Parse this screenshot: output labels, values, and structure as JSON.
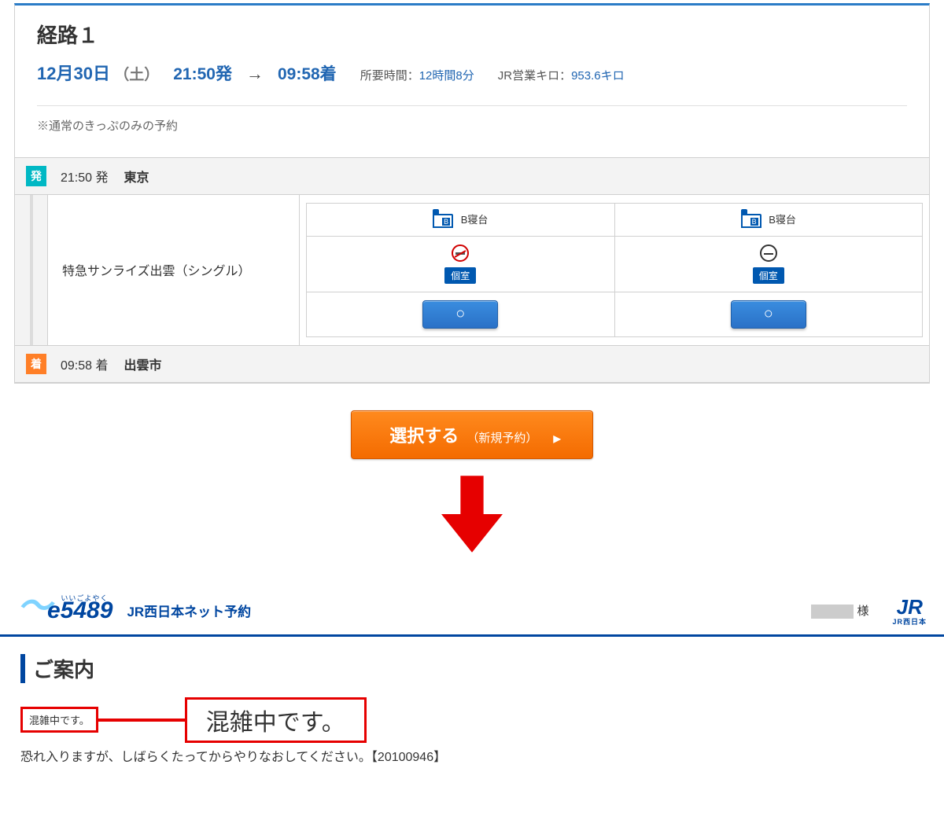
{
  "route": {
    "title": "経路１",
    "date": "12月30日",
    "day": "（土）",
    "dep_time": "21:50発",
    "arr_time": "09:58着",
    "duration_label": "所要時間：",
    "duration_value": "12時間8分",
    "distance_label": "JR営業キロ：",
    "distance_value": "953.6キロ",
    "note": "※通常のきっぷのみの予約"
  },
  "itin": {
    "dep_badge": "発",
    "dep_time": "21:50 発",
    "dep_station": "東京",
    "train_name": "特急サンライズ出雲（シングル）",
    "arr_badge": "着",
    "arr_time": "09:58 着",
    "arr_station": "出雲市"
  },
  "seats": {
    "bed_label": "B寝台",
    "room_label": "個室",
    "select_circle": "○"
  },
  "select_button": {
    "main": "選択する",
    "sub": "（新規予約）"
  },
  "eheader": {
    "logo_ruby": "いいごよやく",
    "logo_text": "5489",
    "service": "JR西日本ネット予約",
    "user_suffix": "様",
    "jr_sub": "JR西日本"
  },
  "notice": {
    "heading": "ご案内",
    "busy_small": "混雑中です。",
    "busy_big": "混雑中です。",
    "body": "恐れ入りますが、しばらくたってからやりなおしてください。【20100946】"
  }
}
